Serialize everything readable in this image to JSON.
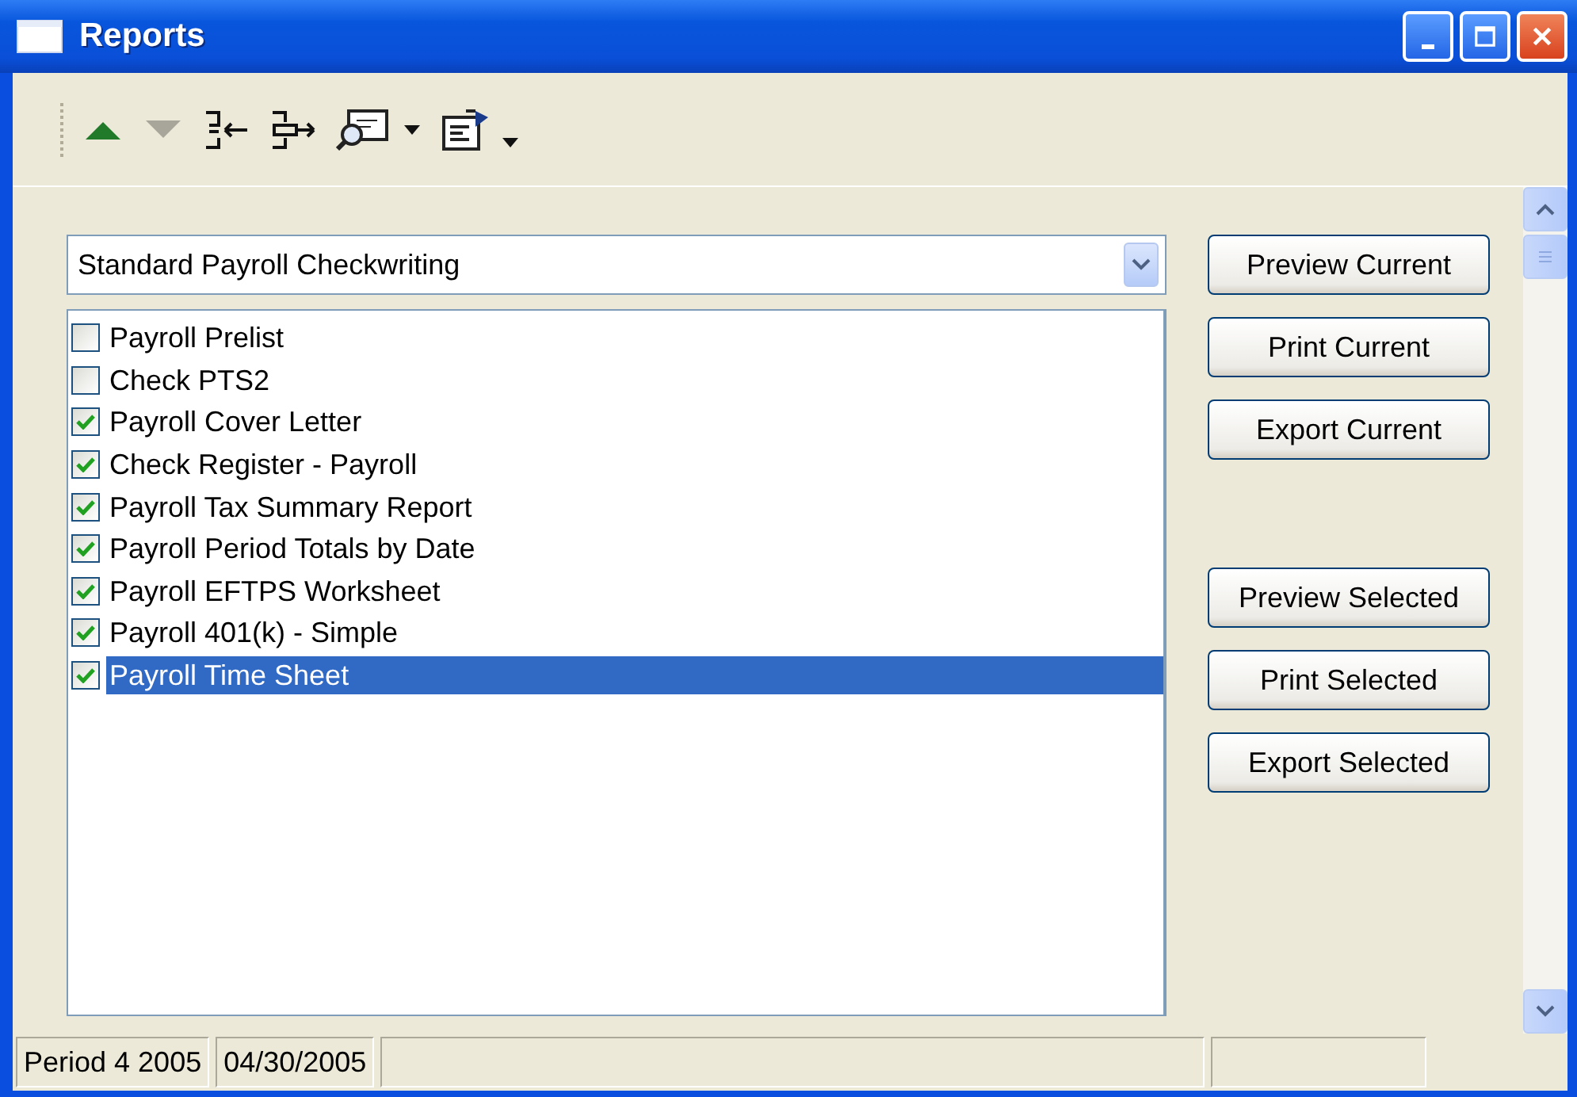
{
  "window": {
    "title": "Reports"
  },
  "toolbar": [
    {
      "kind": "up",
      "disabled": false
    },
    {
      "kind": "down",
      "disabled": true
    },
    {
      "kind": "insert-left",
      "disabled": false
    },
    {
      "kind": "insert-right",
      "disabled": false
    },
    {
      "kind": "preview",
      "disabled": false
    },
    {
      "kind": "dropdown",
      "disabled": false
    },
    {
      "kind": "properties",
      "disabled": false
    },
    {
      "kind": "overflow",
      "disabled": false
    }
  ],
  "report_set": {
    "value": "Standard Payroll Checkwriting"
  },
  "reports": [
    {
      "label": "Payroll Prelist",
      "checked": false,
      "selected": false
    },
    {
      "label": "Check PTS2",
      "checked": false,
      "selected": false
    },
    {
      "label": "Payroll Cover Letter",
      "checked": true,
      "selected": false
    },
    {
      "label": "Check Register - Payroll",
      "checked": true,
      "selected": false
    },
    {
      "label": "Payroll Tax Summary Report",
      "checked": true,
      "selected": false
    },
    {
      "label": "Payroll Period Totals by Date",
      "checked": true,
      "selected": false
    },
    {
      "label": "Payroll EFTPS Worksheet",
      "checked": true,
      "selected": false
    },
    {
      "label": "Payroll 401(k) - Simple",
      "checked": true,
      "selected": false
    },
    {
      "label": "Payroll Time Sheet",
      "checked": true,
      "selected": true
    }
  ],
  "buttons_current": [
    "Preview Current",
    "Print Current",
    "Export Current"
  ],
  "buttons_selected": [
    "Preview Selected",
    "Print Selected",
    "Export Selected"
  ],
  "status_bar": [
    "Period 4 2005",
    "04/30/2005"
  ]
}
